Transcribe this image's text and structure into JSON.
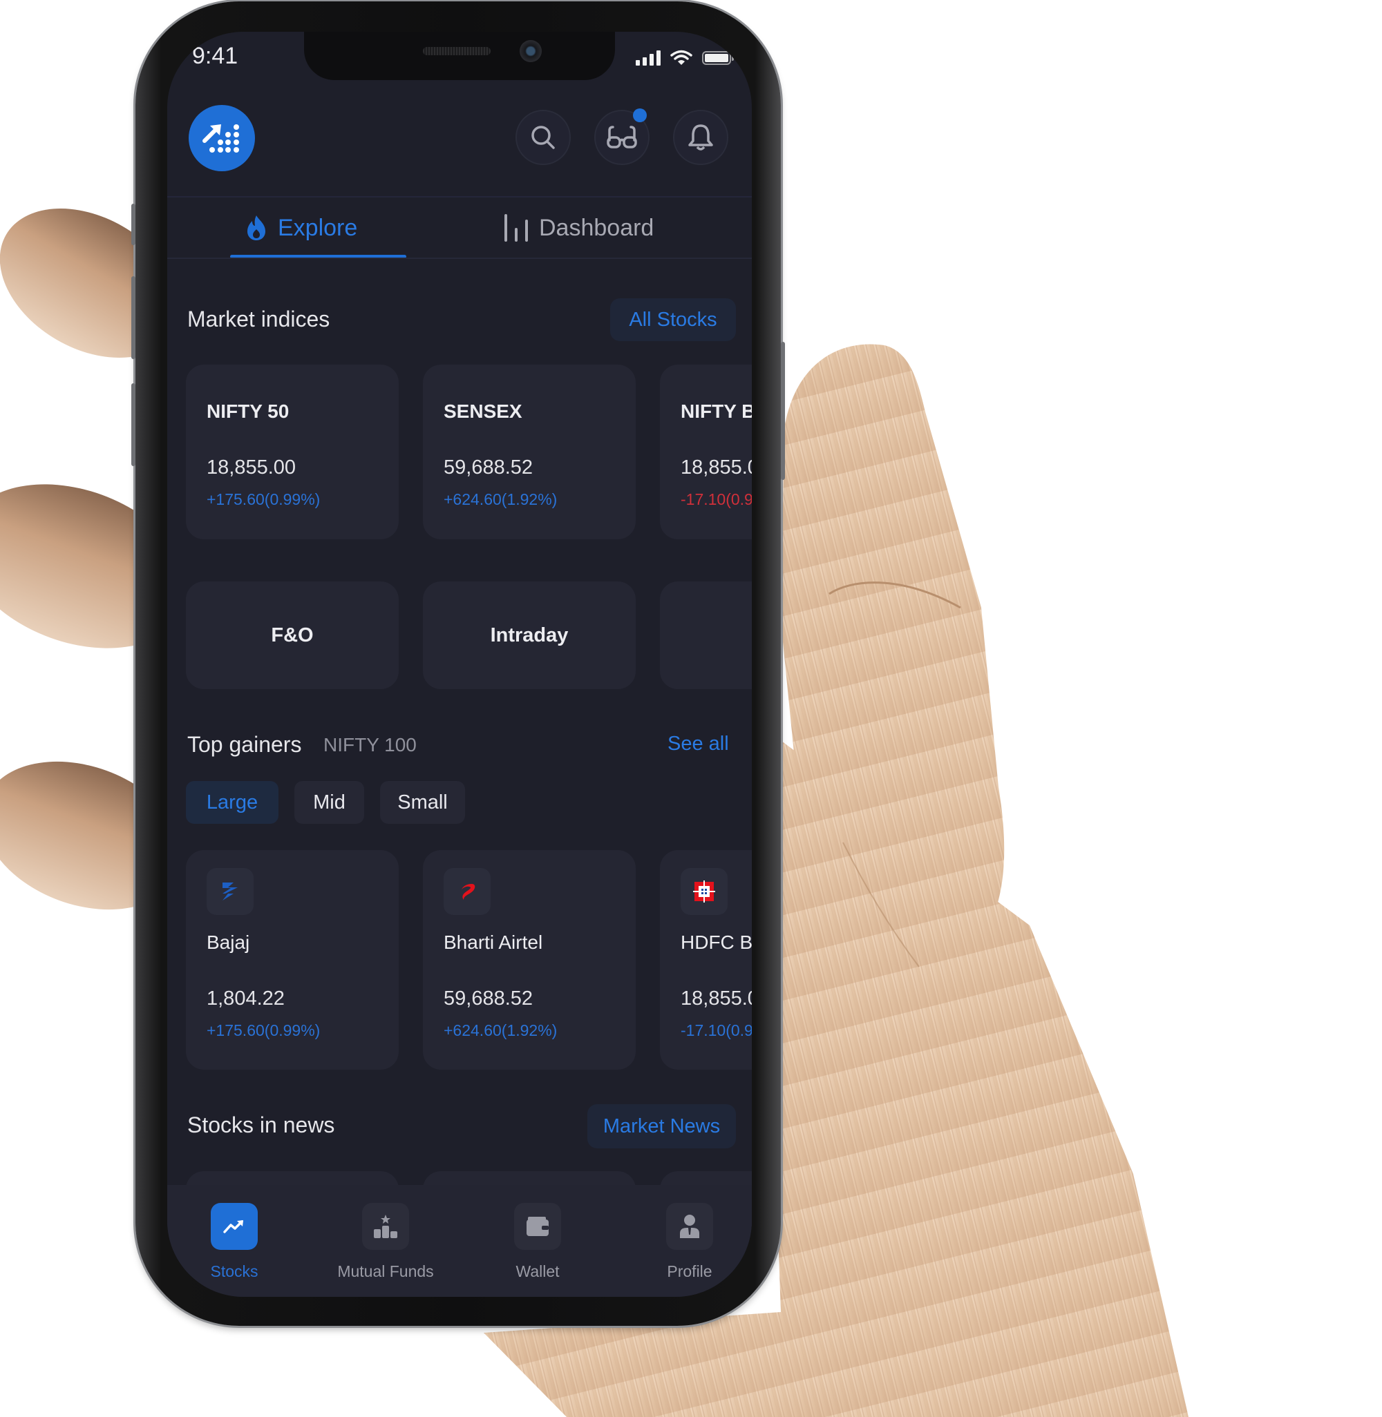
{
  "status_bar": {
    "time": "9:41"
  },
  "header": {
    "logo_icon": "growth-chart-logo-icon",
    "icons": [
      {
        "name": "search-icon",
        "label": "Search"
      },
      {
        "name": "glasses-icon",
        "label": "Watchlist",
        "has_badge": true
      },
      {
        "name": "bell-icon",
        "label": "Notifications"
      }
    ]
  },
  "tabs": [
    {
      "label": "Explore",
      "icon": "flame-icon",
      "active": true
    },
    {
      "label": "Dashboard",
      "icon": "bar-chart-icon",
      "active": false
    }
  ],
  "market_indices": {
    "title": "Market indices",
    "button_label": "All Stocks",
    "cards": [
      {
        "name": "NIFTY 50",
        "price": "18,855.00",
        "change": "+175.60(0.99%)",
        "direction": "up"
      },
      {
        "name": "SENSEX",
        "price": "59,688.52",
        "change": "+624.60(1.92%)",
        "direction": "up"
      },
      {
        "name": "NIFTY B",
        "price": "18,855.0",
        "change": "-17.10(0.9",
        "direction": "down"
      }
    ]
  },
  "categories": [
    {
      "label": "F&O"
    },
    {
      "label": "Intraday"
    },
    {
      "label": ""
    }
  ],
  "top_gainers": {
    "title": "Top gainers",
    "subtitle": "NIFTY 100",
    "link_label": "See all",
    "chips": [
      {
        "label": "Large",
        "active": true
      },
      {
        "label": "Mid",
        "active": false
      },
      {
        "label": "Small",
        "active": false
      }
    ],
    "stocks": [
      {
        "name": "Bajaj",
        "logo": "bajaj-logo-icon",
        "price": "1,804.22",
        "change": "+175.60(0.99%)"
      },
      {
        "name": "Bharti Airtel",
        "logo": "airtel-logo-icon",
        "price": "59,688.52",
        "change": "+624.60(1.92%)"
      },
      {
        "name": "HDFC B",
        "logo": "hdfc-logo-icon",
        "price": "18,855.0",
        "change": "-17.10(0.9"
      }
    ]
  },
  "stocks_in_news": {
    "title": "Stocks in news",
    "button_label": "Market News"
  },
  "bottom_nav": [
    {
      "label": "Stocks",
      "icon": "trending-up-icon",
      "active": true
    },
    {
      "label": "Mutual Funds",
      "icon": "podium-icon",
      "active": false
    },
    {
      "label": "Wallet",
      "icon": "wallet-icon",
      "active": false
    },
    {
      "label": "Profile",
      "icon": "user-icon",
      "active": false
    }
  ],
  "colors": {
    "accent": "#1f6fd6",
    "background": "#1e1f2a",
    "card": "#252633",
    "positive": "#2a72d6",
    "negative": "#d0303a"
  }
}
